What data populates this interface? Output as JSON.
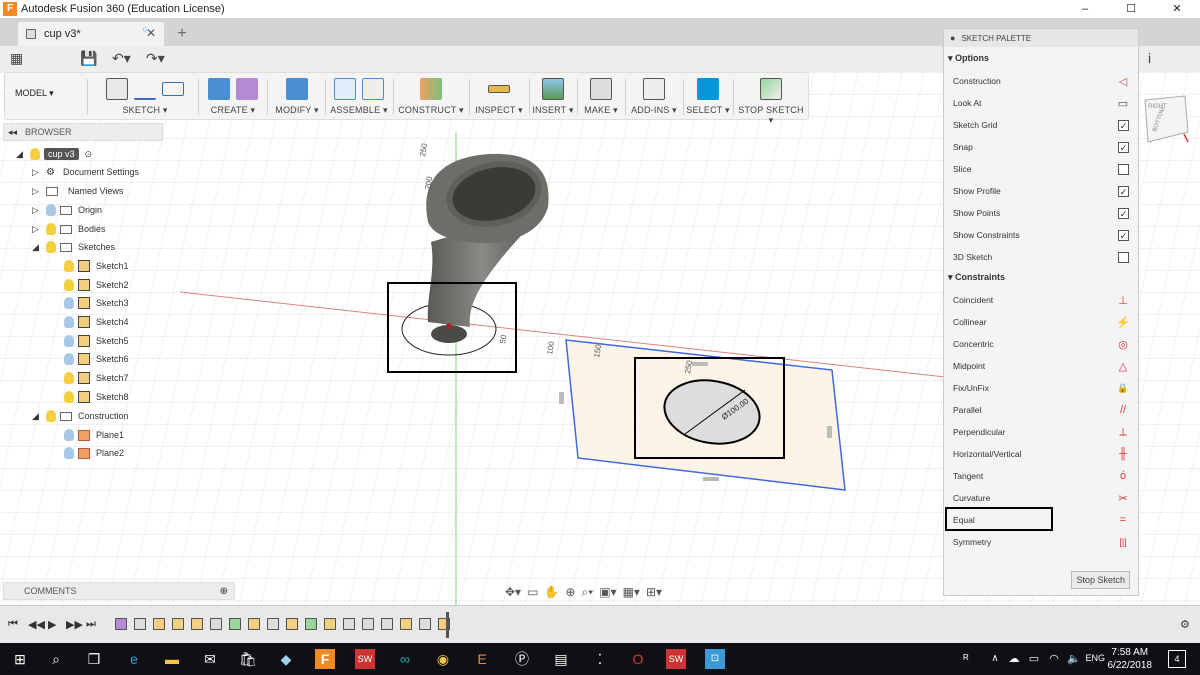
{
  "window": {
    "title": "Autodesk Fusion 360 (Education License)",
    "minimize": "–",
    "maximize": "☐",
    "close": "✕"
  },
  "tab": {
    "label": "cup v3*",
    "close": "✕",
    "new": "+"
  },
  "toolbar": {
    "model": "MODEL ▾",
    "groups": [
      "SKETCH ▾",
      "CREATE ▾",
      "MODIFY ▾",
      "ASSEMBLE ▾",
      "CONSTRUCT ▾",
      "INSPECT ▾",
      "INSERT ▾",
      "MAKE ▾",
      "ADD-INS ▾",
      "SELECT ▾",
      "STOP SKETCH ▾"
    ]
  },
  "browser": {
    "title": "BROWSER",
    "items": [
      {
        "label": "cup v3",
        "level": 0
      },
      {
        "label": "Document Settings",
        "level": 1
      },
      {
        "label": "Named Views",
        "level": 1
      },
      {
        "label": "Origin",
        "level": 1
      },
      {
        "label": "Bodies",
        "level": 1
      },
      {
        "label": "Sketches",
        "level": 1
      },
      {
        "label": "Sketch1",
        "level": 2
      },
      {
        "label": "Sketch2",
        "level": 2
      },
      {
        "label": "Sketch3",
        "level": 2
      },
      {
        "label": "Sketch4",
        "level": 2
      },
      {
        "label": "Sketch5",
        "level": 2
      },
      {
        "label": "Sketch6",
        "level": 2
      },
      {
        "label": "Sketch7",
        "level": 2
      },
      {
        "label": "Sketch8",
        "level": 2
      },
      {
        "label": "Construction",
        "level": 1
      },
      {
        "label": "Plane1",
        "level": 2
      },
      {
        "label": "Plane2",
        "level": 2
      }
    ]
  },
  "comments": {
    "label": "COMMENTS"
  },
  "palette": {
    "title": "SKETCH PALETTE",
    "options_label": "Options",
    "options": [
      {
        "label": "Construction",
        "type": "icon",
        "icon": "◁"
      },
      {
        "label": "Look At",
        "type": "icon",
        "icon": "▭"
      },
      {
        "label": "Sketch Grid",
        "type": "check",
        "checked": "✓"
      },
      {
        "label": "Snap",
        "type": "check",
        "checked": "✓"
      },
      {
        "label": "Slice",
        "type": "check",
        "checked": ""
      },
      {
        "label": "Show Profile",
        "type": "check",
        "checked": "✓"
      },
      {
        "label": "Show Points",
        "type": "check",
        "checked": "✓"
      },
      {
        "label": "Show Constraints",
        "type": "check",
        "checked": "✓"
      },
      {
        "label": "3D Sketch",
        "type": "check",
        "checked": ""
      }
    ],
    "constraints_label": "Constraints",
    "constraints": [
      {
        "label": "Coincident",
        "icon": "⊥"
      },
      {
        "label": "Collinear",
        "icon": "⚡"
      },
      {
        "label": "Concentric",
        "icon": "◎"
      },
      {
        "label": "Midpoint",
        "icon": "△"
      },
      {
        "label": "Fix/UnFix",
        "icon": "🔒"
      },
      {
        "label": "Parallel",
        "icon": "//"
      },
      {
        "label": "Perpendicular",
        "icon": "⟂"
      },
      {
        "label": "Horizontal/Vertical",
        "icon": "╫"
      },
      {
        "label": "Tangent",
        "icon": "ό"
      },
      {
        "label": "Curvature",
        "icon": "✂"
      },
      {
        "label": "Equal",
        "icon": "="
      },
      {
        "label": "Symmetry",
        "icon": "[|]"
      }
    ],
    "stop_sketch": "Stop Sketch"
  },
  "viewport": {
    "dims": [
      "250",
      "200",
      "100",
      "150",
      "250",
      "50",
      "Ø100.00"
    ],
    "viewcube_label": "RIGHT",
    "viewcube_face": "BOTTOM"
  },
  "taskbar": {
    "time": "7:58 AM",
    "date": "6/22/2018",
    "lang": "ENG",
    "notifications": "4"
  },
  "colors": {
    "accent": "#0696d7",
    "sketch_plane": "#fdf0e0",
    "plane_border": "#4169e1",
    "highlight_box": "#000000"
  }
}
